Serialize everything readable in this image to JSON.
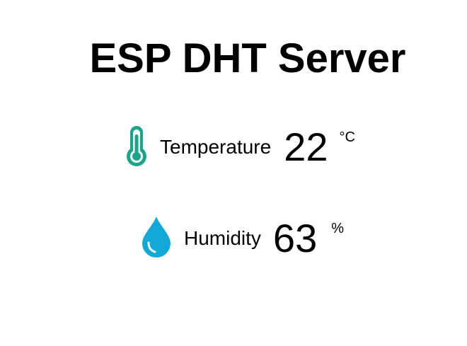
{
  "title": "ESP DHT Server",
  "colors": {
    "temperature_icon": "#1aa58a",
    "humidity_icon": "#12a8d8"
  },
  "temperature": {
    "icon": "thermometer-icon",
    "label": "Temperature",
    "value": "22",
    "unit": "°C"
  },
  "humidity": {
    "icon": "water-drop-icon",
    "label": "Humidity",
    "value": "63",
    "unit": "%"
  }
}
